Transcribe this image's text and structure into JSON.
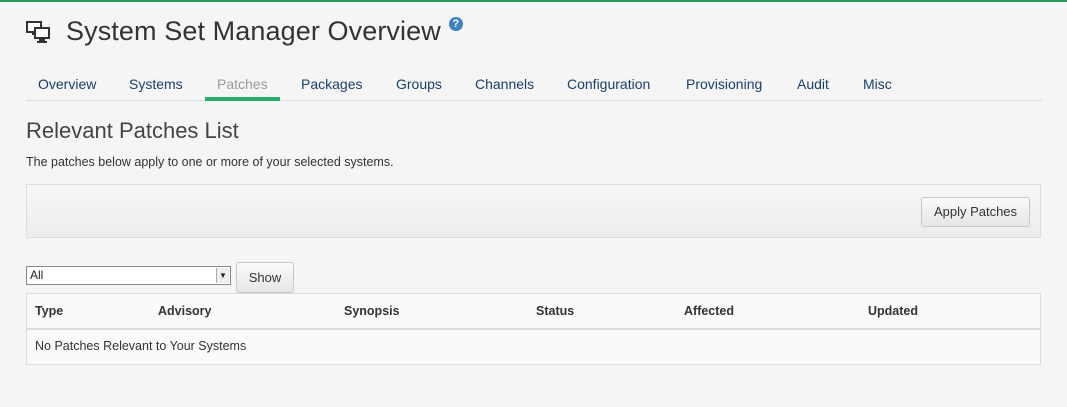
{
  "page": {
    "title": "System Set Manager Overview",
    "help_glyph": "?"
  },
  "tabs": [
    {
      "label": "Overview"
    },
    {
      "label": "Systems"
    },
    {
      "label": "Patches",
      "active": true
    },
    {
      "label": "Packages"
    },
    {
      "label": "Groups"
    },
    {
      "label": "Channels"
    },
    {
      "label": "Configuration"
    },
    {
      "label": "Provisioning"
    },
    {
      "label": "Audit"
    },
    {
      "label": "Misc"
    }
  ],
  "section": {
    "title": "Relevant Patches List",
    "description": "The patches below apply to one or more of your selected systems."
  },
  "toolbar": {
    "apply_label": "Apply Patches"
  },
  "filter": {
    "selected": "All",
    "show_label": "Show"
  },
  "table": {
    "columns": [
      "Type",
      "Advisory",
      "Synopsis",
      "Status",
      "Affected",
      "Updated"
    ],
    "empty_message": "No Patches Relevant to Your Systems"
  },
  "colors": {
    "accent": "#2aae6b",
    "link": "#19406a",
    "help": "#3b82c4"
  },
  "icons": {
    "header": "systems-icon",
    "help": "help-icon"
  }
}
